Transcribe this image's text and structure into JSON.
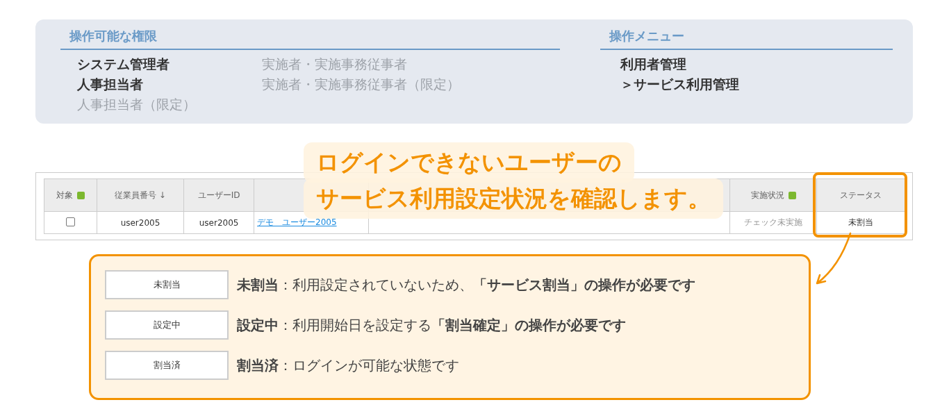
{
  "permissions": {
    "title": "操作可能な権限",
    "roles": [
      {
        "label": "システム管理者",
        "enabled": true
      },
      {
        "label": "人事担当者",
        "enabled": true
      },
      {
        "label": "人事担当者（限定）",
        "enabled": false
      },
      {
        "label": "実施者・実施事務従事者",
        "enabled": false
      },
      {
        "label": "実施者・実施事務従事者（限定）",
        "enabled": false
      }
    ]
  },
  "menu": {
    "title": "操作メニュー",
    "items": [
      {
        "label": "利用者管理"
      },
      {
        "label": "＞サービス利用管理"
      }
    ]
  },
  "table": {
    "columns": [
      {
        "label": "対象",
        "help": true
      },
      {
        "label": "従業員番号 ↓",
        "help": false
      },
      {
        "label": "ユーザーID",
        "help": false
      },
      {
        "help": false
      },
      {
        "help": false
      },
      {
        "label": "実施状況",
        "help": true
      },
      {
        "label": "ステータス",
        "help": false
      }
    ],
    "rows": [
      {
        "checked": false,
        "employee_no": "user2005",
        "user_id": "user2005",
        "name": "デモ　ユーザー2005",
        "exam_status": "チェック未実施",
        "status": "未割当"
      }
    ]
  },
  "callout": {
    "lines": [
      "ログインできないユーザーの",
      "サービス利用設定状況を確認します。"
    ]
  },
  "legend": [
    {
      "status": "未割当",
      "text": "**未割当**：利用設定されていないため、**「サービス割当」の操作が必要です**"
    },
    {
      "status": "設定中",
      "text": "**設定中**：利用開始日を設定する**「割当確定」の操作が必要です**"
    },
    {
      "status": "割当済",
      "text": "**割当済**：ログインが可能な状態です"
    }
  ]
}
